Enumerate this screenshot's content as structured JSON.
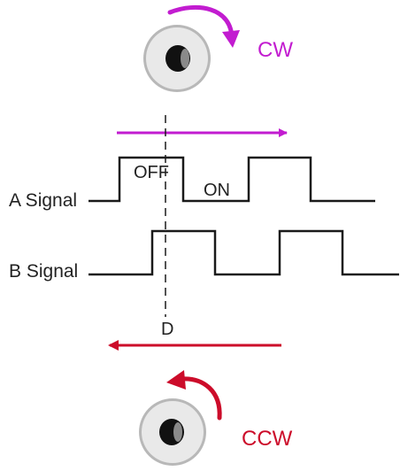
{
  "colors": {
    "cw": "#c21cd0",
    "ccw": "#cc0c2a",
    "line": "#1a1a1a",
    "knob_face": "#e9e9e9",
    "knob_rim": "#b8b8b8",
    "knob_hole": "#111111"
  },
  "icons": {
    "cw_rotation": "clockwise-arrow-icon",
    "ccw_rotation": "counterclockwise-arrow-icon",
    "knob": "rotary-knob-icon"
  },
  "labels": {
    "cw": "CW",
    "ccw": "CCW",
    "a_signal": "A Signal",
    "b_signal": "B Signal",
    "off": "OFF",
    "on": "ON",
    "detent": "D"
  }
}
